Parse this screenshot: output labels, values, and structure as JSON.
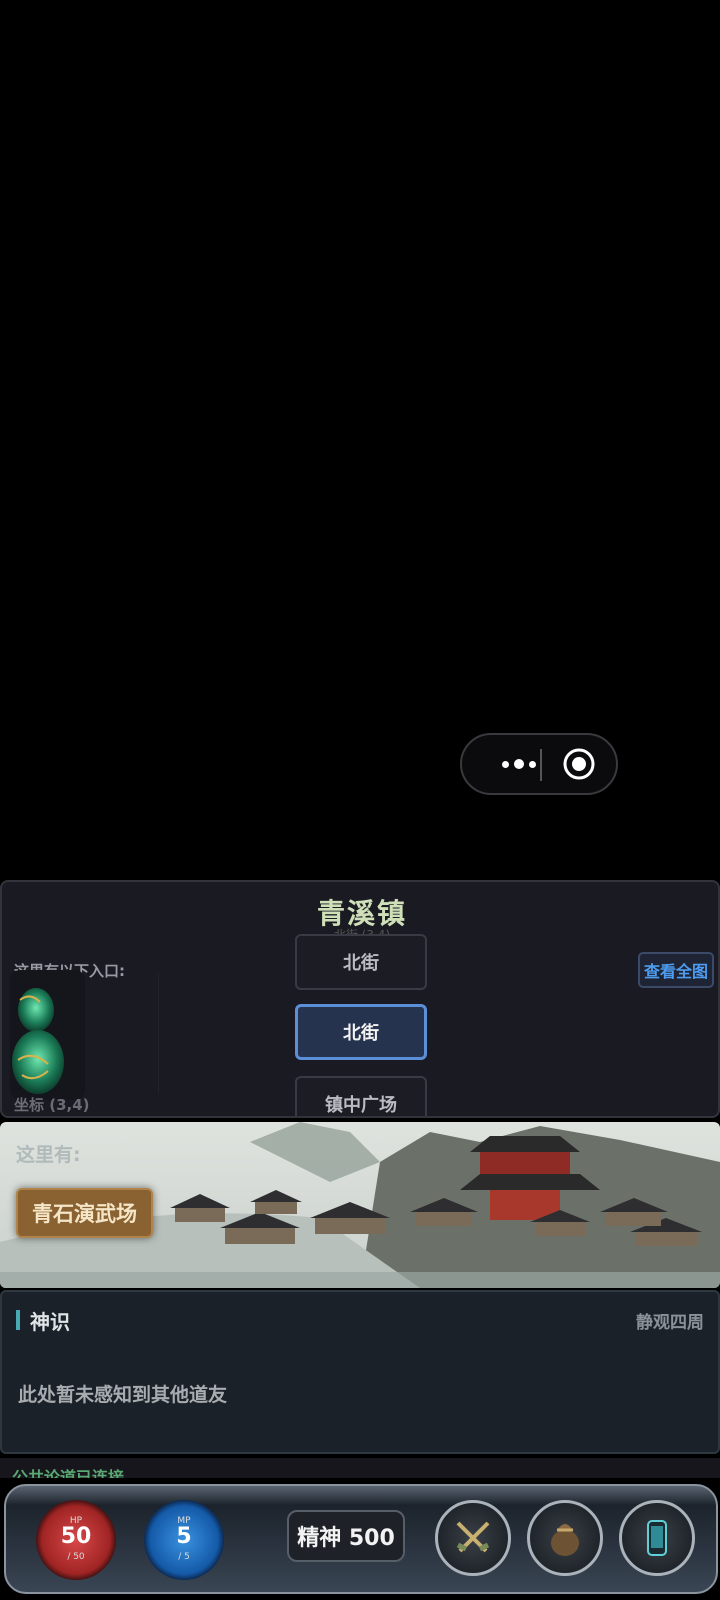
{
  "capsule": {
    "more_icon": "more-dots-icon",
    "close_icon": "target-circle-icon"
  },
  "map": {
    "title": "青溪镇",
    "subtitle": "北街 (3,4)",
    "entrances_label": "这里有以下入口:",
    "view_all": "查看全图",
    "coord": "坐标 (3,4)",
    "nodes": {
      "north_prev": "北街",
      "current": "北街",
      "south": "镇中广场"
    }
  },
  "scene": {
    "here_label": "这里有:",
    "place_button": "青石演武场"
  },
  "sense": {
    "title": "神识",
    "action": "静观四周",
    "empty": "此处暂未感知到其他道友"
  },
  "chat_peek": "公共论道已连接",
  "bottom": {
    "hp": {
      "label": "HP",
      "value": "50",
      "max": "/ 50"
    },
    "mp": {
      "label": "MP",
      "value": "5",
      "max": "/ 5"
    },
    "spirit": "精神 500",
    "icons": [
      "crossed-swords-icon",
      "bag-icon",
      "phone-icon"
    ]
  },
  "colors": {
    "accent_blue": "#5b8fd8",
    "place_button": "#8a6232",
    "hp_red": "#d84848",
    "mp_blue": "#3a92e0"
  }
}
